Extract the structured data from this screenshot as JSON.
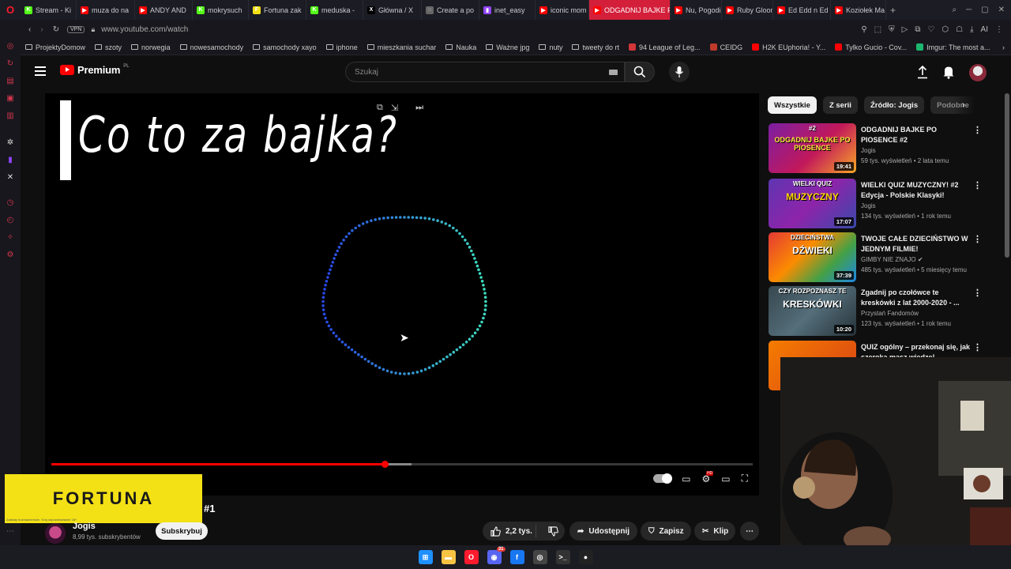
{
  "browser": {
    "tabs": [
      {
        "label": "Stream - Ki",
        "fav_color": "#53fc18",
        "fav_char": "K"
      },
      {
        "label": "muza do na",
        "fav_color": "#ff0000",
        "fav_char": "▶"
      },
      {
        "label": "ANDY AND",
        "fav_color": "#ff0000",
        "fav_char": "▶"
      },
      {
        "label": "mokrysuch",
        "fav_color": "#53fc18",
        "fav_char": "K"
      },
      {
        "label": "Fortuna zak",
        "fav_color": "#f3e116",
        "fav_char": "F"
      },
      {
        "label": "meduska -",
        "fav_color": "#53fc18",
        "fav_char": "K"
      },
      {
        "label": "Główna / X",
        "fav_color": "#000000",
        "fav_char": "X"
      },
      {
        "label": "Create a po",
        "fav_color": "#666666",
        "fav_char": "◌"
      },
      {
        "label": "inet_easy",
        "fav_color": "#9146ff",
        "fav_char": "▮"
      },
      {
        "label": "iconic mom",
        "fav_color": "#ff0000",
        "fav_char": "▶"
      },
      {
        "label": "ODGADNIJ BAJKE P",
        "fav_color": "#ff0000",
        "fav_char": "▶",
        "active": true
      },
      {
        "label": "Nu, Pogodi",
        "fav_color": "#ff0000",
        "fav_char": "▶"
      },
      {
        "label": "Ruby Gloom",
        "fav_color": "#ff0000",
        "fav_char": "▶"
      },
      {
        "label": "Ed Edd n Ed",
        "fav_color": "#ff0000",
        "fav_char": "▶"
      },
      {
        "label": "Koziołek Ma",
        "fav_color": "#ff0000",
        "fav_char": "▶"
      }
    ],
    "vpn_label": "VPN",
    "url": "www.youtube.com/watch",
    "ai_label": "AI",
    "bookmarks": [
      {
        "label": "ProjektyDomow",
        "type": "folder"
      },
      {
        "label": "szoty",
        "type": "folder"
      },
      {
        "label": "norwegia",
        "type": "folder"
      },
      {
        "label": "nowesamochody",
        "type": "folder"
      },
      {
        "label": "samochody xayo",
        "type": "folder"
      },
      {
        "label": "iphone",
        "type": "folder"
      },
      {
        "label": "mieszkania suchar",
        "type": "folder"
      },
      {
        "label": "Nauka",
        "type": "folder"
      },
      {
        "label": "Ważne jpg",
        "type": "folder"
      },
      {
        "label": "nuty",
        "type": "folder"
      },
      {
        "label": "tweety do rt",
        "type": "folder"
      },
      {
        "label": "94 League of Leg...",
        "type": "site",
        "color": "#d13639"
      },
      {
        "label": "CEIDG",
        "type": "site",
        "color": "#c0392b"
      },
      {
        "label": "H2K EUphoria! - Y...",
        "type": "site",
        "color": "#ff0000"
      },
      {
        "label": "Tylko Gucio - Cov...",
        "type": "site",
        "color": "#ff0000"
      },
      {
        "label": "Imgur: The most a...",
        "type": "site",
        "color": "#1bb76e"
      }
    ]
  },
  "youtube": {
    "logo_text": "Premium",
    "logo_region": "PL",
    "search_placeholder": "Szukaj",
    "player": {
      "video_text": "Co to za bajka?",
      "progress_fraction": 0.4748,
      "buffer_fraction": 0.5135,
      "hd_badge": "HD"
    },
    "below": {
      "sponsor_text": "FORTUNA",
      "sponsor_fine_print": "Zakłady bukmacherskie. Graj odpowiedzialnie 18+",
      "title_suffix": "#1",
      "channel_name": "Jogis",
      "channel_subs": "8,99 tys. subskrybentów",
      "subscribe_label": "Subskrybuj",
      "like_count": "2,2 tys.",
      "share_label": "Udostępnij",
      "save_label": "Zapisz",
      "clip_label": "Klip"
    },
    "chips": [
      {
        "label": "Wszystkie",
        "active": true
      },
      {
        "label": "Z serii"
      },
      {
        "label": "Źródło: Jogis"
      },
      {
        "label": "Podobne"
      }
    ],
    "recommendations": [
      {
        "title": "ODGADNIJ BAJKE PO PIOSENCE #2",
        "channel": "Jogis",
        "meta": "59 tys. wyświetleń • 2 lata temu",
        "duration": "19:41",
        "thumb_text": "ODGADNIJ BAJKE PO PIOSENCE",
        "thumb_badge": "#2",
        "thumb_bg": "linear-gradient(135deg,#7b1fa2 0%,#c2185b 55%,#f9a825 100%)",
        "thumb_text_color": "#ffeb3b"
      },
      {
        "title": "WIELKI QUIZ MUZYCZNY! #2 Edycja - Polskie Klasyki!",
        "channel": "Jogis",
        "meta": "134 tys. wyświetleń • 1 rok temu",
        "duration": "17:07",
        "thumb_text": "MUZYCZNY",
        "thumb_badge": "WIELKI QUIZ",
        "thumb_bg": "linear-gradient(135deg,#5e35b1 0%,#8e24aa 50%,#3949ab 100%)",
        "thumb_text_color": "#ffd600"
      },
      {
        "title": "TWOJE CAŁE DZIECIŃSTWO W JEDNYM FILMIE!",
        "channel": "GIMBY NIE ZNAJO",
        "verified": true,
        "meta": "485 tys. wyświetleń • 5 miesięcy temu",
        "duration": "37:39",
        "thumb_text": "DŹWIEKI",
        "thumb_badge": "DZIECIŃSTWA",
        "thumb_bg": "linear-gradient(135deg,#e53935 0%,#fb8c00 40%,#43a047 70%,#1e88e5 100%)",
        "thumb_text_color": "#ffffff"
      },
      {
        "title": "Zgadnij po czołówce te kreskówki z lat 2000-2020 - ...",
        "channel": "Przystań Fandomów",
        "meta": "123 tys. wyświetleń • 1 rok temu",
        "duration": "10:20",
        "thumb_text": "KRESKÓWKI",
        "thumb_badge": "CZY ROZPOZNASZ TE",
        "thumb_bg": "linear-gradient(135deg,#37474f 0%,#546e7a 50%,#263238 100%)",
        "thumb_text_color": "#ffffff"
      },
      {
        "title": "QUIZ ogólny – przekonaj się, jak szeroka masz wiedzę!",
        "channel": "",
        "meta": "",
        "duration": "",
        "thumb_text": "",
        "thumb_badge": "",
        "thumb_bg": "linear-gradient(135deg,#f57c00 0%,#d84315 100%)",
        "thumb_text_color": "#ffffff"
      }
    ]
  },
  "taskbar": {
    "icons": [
      {
        "name": "windows-start-icon",
        "color": "#1e90ff",
        "char": "⊞"
      },
      {
        "name": "file-explorer-icon",
        "color": "#f6c343",
        "char": "▬"
      },
      {
        "name": "opera-gx-icon",
        "color": "#ff1b2d",
        "char": "O"
      },
      {
        "name": "discord-icon",
        "color": "#5865f2",
        "char": "◉"
      },
      {
        "name": "facebook-icon",
        "color": "#1877f2",
        "char": "f"
      },
      {
        "name": "obs-icon",
        "color": "#444444",
        "char": "◎"
      },
      {
        "name": "terminal-icon",
        "color": "#333333",
        "char": ">_"
      },
      {
        "name": "media-player-icon",
        "color": "#222222",
        "char": "●"
      }
    ],
    "discord_badge": "31"
  }
}
